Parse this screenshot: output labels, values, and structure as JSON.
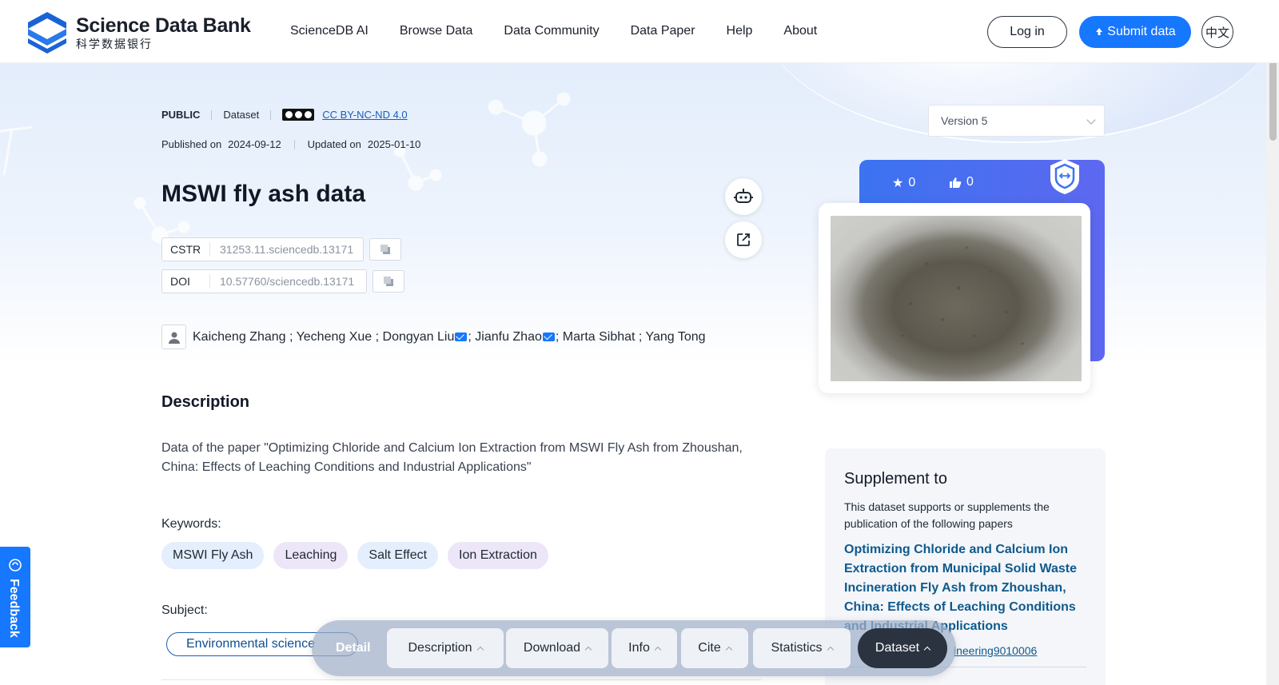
{
  "header": {
    "logo_en": "Science Data Bank",
    "logo_cn": "科学数据银行",
    "nav": [
      "ScienceDB AI",
      "Browse Data",
      "Data Community",
      "Data Paper",
      "Help",
      "About"
    ],
    "login_label": "Log in",
    "submit_label": "Submit data",
    "lang_label": "中文"
  },
  "meta": {
    "access": "PUBLIC",
    "type": "Dataset",
    "license": "CC BY-NC-ND 4.0",
    "published_label": "Published on",
    "published_date": "2024-09-12",
    "updated_label": "Updated on",
    "updated_date": "2025-01-10"
  },
  "dataset": {
    "title": "MSWI fly ash data",
    "cstr_label": "CSTR",
    "cstr_value": "31253.11.sciencedb.13171",
    "doi_label": "DOI",
    "doi_value": "10.57760/sciencedb.13171"
  },
  "authors": {
    "a1": "Kaicheng Zhang ; Yecheng Xue ; Dongyan Liu",
    "a2": "; Jianfu Zhao",
    "a3": "; Marta Sibhat ; Yang Tong"
  },
  "description": {
    "heading": "Description",
    "text": "Data of the paper \"Optimizing Chloride and Calcium Ion Extraction from MSWI Fly Ash from Zhoushan, China: Effects of Leaching Conditions and Industrial Applications\"",
    "keywords_label": "Keywords:",
    "keywords": [
      "MSWI Fly Ash",
      "Leaching",
      "Salt Effect",
      "Ion Extraction"
    ],
    "subject_label": "Subject:",
    "subject": "Environmental science"
  },
  "sidebar": {
    "version": "Version 5",
    "stars": "0",
    "likes": "0",
    "supplement_title": "Supplement to",
    "supplement_text": "This dataset supports or supplements the publication of the following papers",
    "paper_title": "Optimizing Chloride and Calcium Ion Extraction from Municipal Solid Waste Incineration Fly Ash from Zhoushan, China: Effects of Leaching Conditions and Industrial Applications",
    "paper_link": "ineering9010006"
  },
  "floating_nav": {
    "detail": "Detail",
    "items": [
      "Description",
      "Download",
      "Info",
      "Cite",
      "Statistics",
      "Dataset"
    ]
  },
  "feedback": "Feedback",
  "colors": {
    "accent": "#1677ff",
    "link": "#0f5a8c",
    "dark": "#2b3340"
  }
}
